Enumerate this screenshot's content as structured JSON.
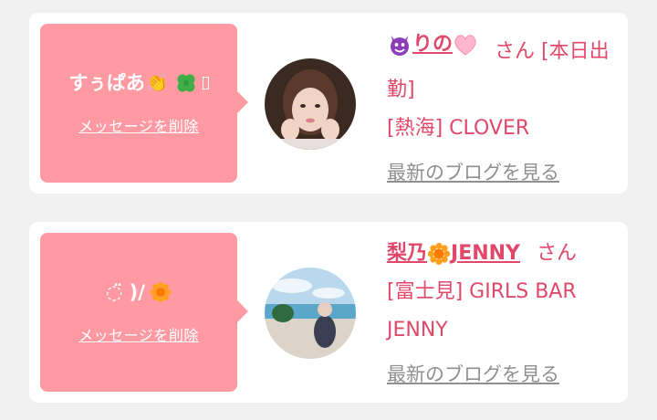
{
  "cards": [
    {
      "message": "すぅぱあ",
      "message_icons": [
        "clap-icon",
        "clover-icon",
        "unknown-glyph"
      ],
      "delete_label": "メッセージを削除",
      "name": "りの",
      "name_icons": [
        "devil-icon",
        "heart-icon"
      ],
      "honorific": "さん",
      "status": "[本日出勤]",
      "shop": "[熱海] CLOVER",
      "blog_label": "最新のブログを見る",
      "avatar": "avatar-woman-portrait"
    },
    {
      "message": "◌̈ )/",
      "message_icons": [
        "flower-icon"
      ],
      "delete_label": "メッセージを削除",
      "name_prefix": "梨乃",
      "name_suffix": "JENNY",
      "name_icons": [
        "sunflower-icon"
      ],
      "honorific": "さん",
      "shop": "[富士見] GIRLS BAR JENNY",
      "blog_label": "最新のブログを見る",
      "avatar": "avatar-beach-photo"
    }
  ],
  "colors": {
    "bubble": "#ff9aa2",
    "accent": "#e0486a",
    "link_gray": "#8f8f8f",
    "background": "#f0f0f0"
  }
}
